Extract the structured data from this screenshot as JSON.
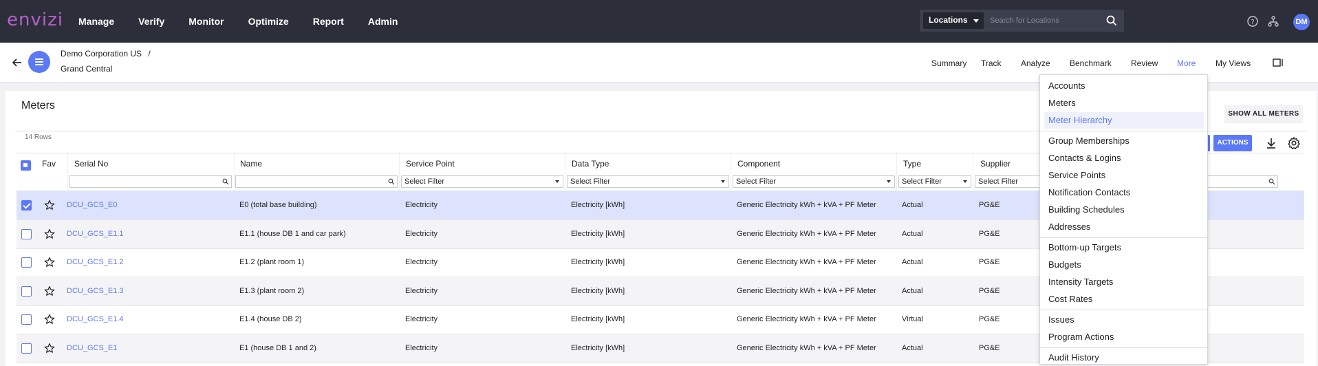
{
  "app": {
    "logo": "envizi",
    "nav": [
      "Manage",
      "Verify",
      "Monitor",
      "Optimize",
      "Report",
      "Admin"
    ]
  },
  "location_search": {
    "selector": "Locations",
    "placeholder": "Search for Locations"
  },
  "user": {
    "initials": "DM"
  },
  "breadcrumb": {
    "org": "Demo Corporation US",
    "separator": "/",
    "site": "Grand Central"
  },
  "tabs": [
    "Summary",
    "Track",
    "Analyze",
    "Benchmark",
    "Review",
    "More",
    "My Views"
  ],
  "active_tab": "More",
  "card": {
    "title": "Meters",
    "row_count": "14 Rows",
    "show_all_label": "SHOW ALL METERS",
    "actions_label": "ACTIONS"
  },
  "table": {
    "columns": [
      "Fav",
      "Serial No",
      "Name",
      "Service Point",
      "Data Type",
      "Component",
      "Type",
      "Supplier"
    ],
    "filter_placeholder": "Select Filter",
    "rows": [
      {
        "serial": "DCU_GCS_E0",
        "name": "E0 (total base building)",
        "service_point": "Electricity",
        "data_type": "Electricity [kWh]",
        "component": "Generic Electricity kWh + kVA + PF Meter",
        "type": "Actual",
        "supplier": "PG&E"
      },
      {
        "serial": "DCU_GCS_E1.1",
        "name": "E1.1 (house DB 1 and car park)",
        "service_point": "Electricity",
        "data_type": "Electricity [kWh]",
        "component": "Generic Electricity kWh + kVA + PF Meter",
        "type": "Actual",
        "supplier": "PG&E"
      },
      {
        "serial": "DCU_GCS_E1.2",
        "name": "E1.2 (plant room 1)",
        "service_point": "Electricity",
        "data_type": "Electricity [kWh]",
        "component": "Generic Electricity kWh + kVA + PF Meter",
        "type": "Actual",
        "supplier": "PG&E"
      },
      {
        "serial": "DCU_GCS_E1.3",
        "name": "E1.3 (plant room 2)",
        "service_point": "Electricity",
        "data_type": "Electricity [kWh]",
        "component": "Generic Electricity kWh + kVA + PF Meter",
        "type": "Actual",
        "supplier": "PG&E"
      },
      {
        "serial": "DCU_GCS_E1.4",
        "name": "E1.4 (house DB 2)",
        "service_point": "Electricity",
        "data_type": "Electricity [kWh]",
        "component": "Generic Electricity kWh + kVA + PF Meter",
        "type": "Virtual",
        "supplier": "PG&E"
      },
      {
        "serial": "DCU_GCS_E1",
        "name": "E1 (house DB 1 and 2)",
        "service_point": "Electricity",
        "data_type": "Electricity [kWh]",
        "component": "Generic Electricity kWh + kVA + PF Meter",
        "type": "Actual",
        "supplier": "PG&E"
      }
    ]
  },
  "more_menu": {
    "groups": [
      [
        "Accounts",
        "Meters",
        "Meter Hierarchy"
      ],
      [
        "Group Memberships",
        "Contacts & Logins",
        "Service Points",
        "Notification Contacts",
        "Building Schedules",
        "Addresses"
      ],
      [
        "Bottom-up Targets",
        "Budgets",
        "Intensity Targets",
        "Cost Rates"
      ],
      [
        "Issues",
        "Program Actions"
      ],
      [
        "Audit History"
      ]
    ],
    "highlighted": "Meter Hierarchy"
  },
  "colors": {
    "accent": "#5b78f6",
    "topbar": "#2c2e3a",
    "logo": "#b560c8",
    "selected_row": "#dde3fd"
  }
}
